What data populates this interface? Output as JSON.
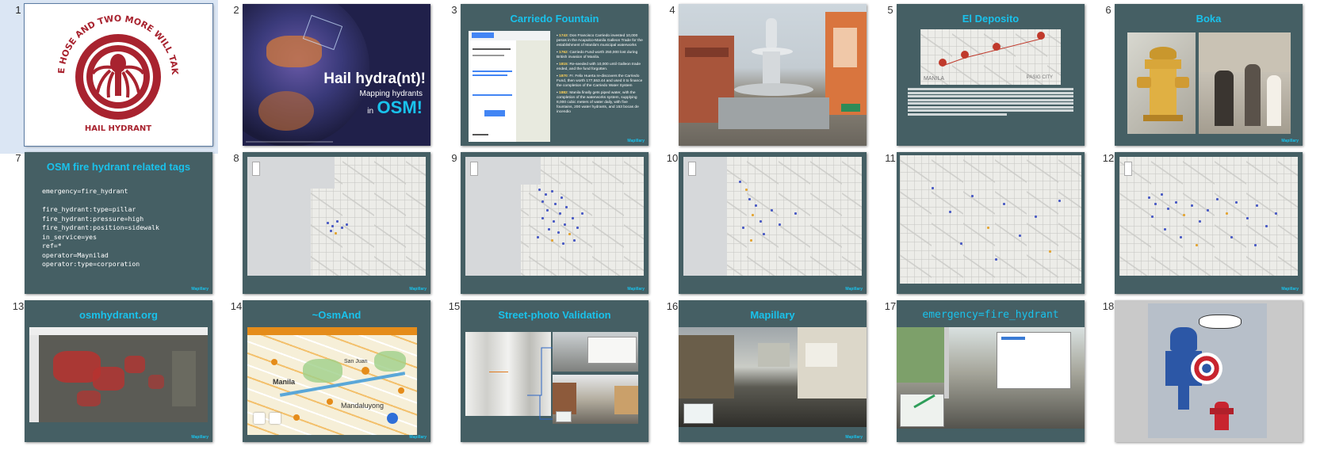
{
  "slides": [
    {
      "num": "1",
      "circle_top": "CUT OFF ONE HOSE AND TWO MORE WILL TAKE ITS PLACE",
      "circle_bottom": "HAIL HYDRANT"
    },
    {
      "num": "2",
      "title_line1": "Hail hydra(nt)!",
      "title_line2": "Mapping hydrants",
      "title_line3_prefix": "in",
      "title_line3_big": "OSM!"
    },
    {
      "num": "3",
      "title": "Carriedo Fountain",
      "bullets": [
        {
          "year": "1743",
          "text": "Don Francisco Carriedo invested 10,000 pesos in the Acapulco-Manila Galleon Trade for the establishment of Manila's municipal waterworks"
        },
        {
          "year": "1762",
          "text": "Carriedo Fund worth 250,000 lost during British invasion of Manila."
        },
        {
          "year": "1815",
          "text": "Re-seeded with 10,000 until Galleon trade ended, and the fund forgotten."
        },
        {
          "year": "1870",
          "text": "Fr. Felix Huerta re-discovers the Carriedo Fund, then worth 177,553.44 and used it to finance the completion of the Carriedo Water System"
        },
        {
          "year": "1882",
          "text": "Manila finally gets piped water, with the completion of the waterworks system, supplying 8,000 cubic meters of water daily, with five fountains, 200 water hydrants, and 153 bocas de incendio"
        }
      ]
    },
    {
      "num": "4"
    },
    {
      "num": "5",
      "title": "El Deposito",
      "map_label_left": "MANILA",
      "map_label_right": "PASIG CITY"
    },
    {
      "num": "6",
      "title": "Boka"
    },
    {
      "num": "7",
      "title": "OSM fire hydrant related tags",
      "tags": "emergency=fire_hydrant\n\nfire_hydrant:type=pillar\nfire_hydrant:pressure=high\nfire_hydrant:position=sidewalk\nin_service=yes\nref=*\noperator=Maynilad\noperator:type=corporation"
    },
    {
      "num": "8"
    },
    {
      "num": "9"
    },
    {
      "num": "10"
    },
    {
      "num": "11"
    },
    {
      "num": "12"
    },
    {
      "num": "13",
      "title": "osmhydrant.org"
    },
    {
      "num": "14",
      "title": "~OsmAnd",
      "map_label_1": "San Juan",
      "map_label_2": "Manila",
      "map_label_3": "Mandaluyong"
    },
    {
      "num": "15",
      "title": "Street-photo Validation"
    },
    {
      "num": "16",
      "title": "Mapillary"
    },
    {
      "num": "17",
      "title": "emergency=fire_hydrant"
    },
    {
      "num": "18"
    }
  ],
  "logo_text": "Mapillary",
  "colors": {
    "slide_bg": "#455f64",
    "title": "#19c2ec",
    "selected_bg": "#dbe6f4",
    "hydra_red": "#a8232f"
  }
}
